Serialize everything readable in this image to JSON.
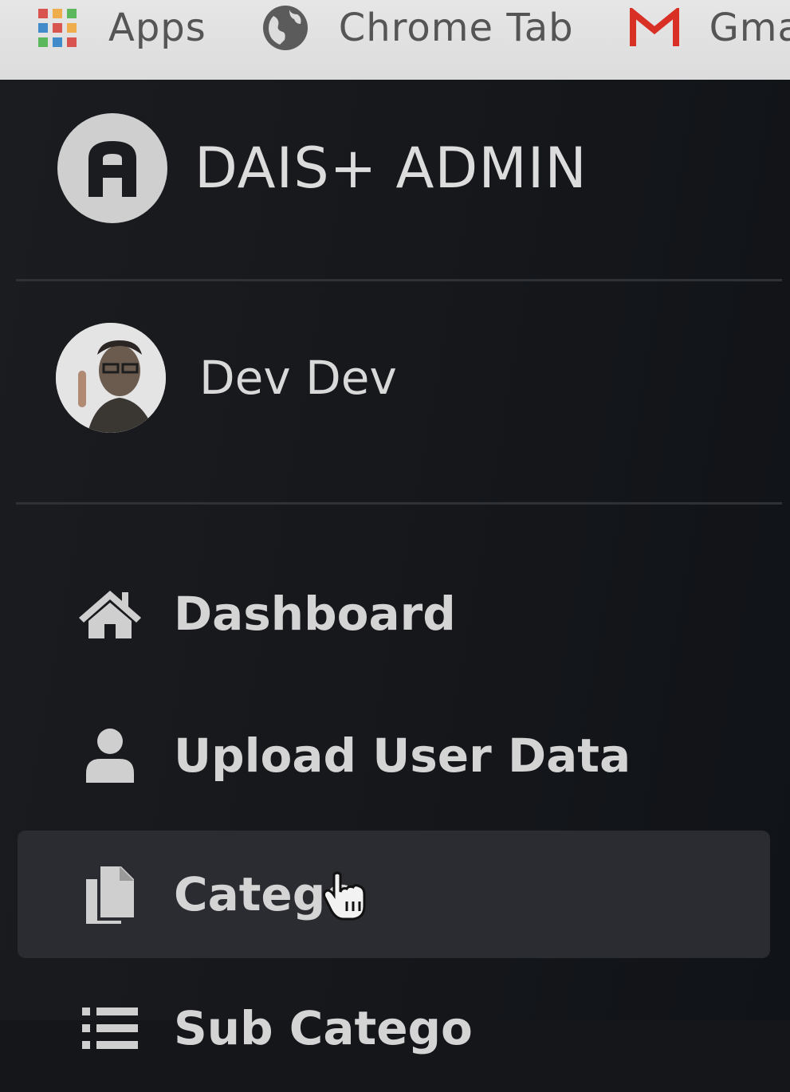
{
  "bookmarks_bar": {
    "items": [
      {
        "label": "Apps",
        "icon": "apps-grid-icon"
      },
      {
        "label": "Chrome Tab",
        "icon": "globe-icon"
      },
      {
        "label": "Gma",
        "icon": "gmail-icon"
      }
    ]
  },
  "sidebar": {
    "brand": {
      "name": "DAIS+ ADMIN",
      "logo_letter": "A"
    },
    "user": {
      "name": "Dev Dev",
      "icon": "avatar"
    },
    "nav": [
      {
        "label": "Dashboard",
        "icon": "home-icon"
      },
      {
        "label": "Upload User Data",
        "icon": "user-icon"
      },
      {
        "label": "Catego",
        "icon": "copy-icon",
        "active": true
      },
      {
        "label": "Sub Catego",
        "icon": "list-icon"
      }
    ]
  },
  "colors": {
    "sidebar_bg": "#15171b",
    "active_bg": "#2a2c31",
    "text": "#d4d4d4",
    "gmail_red": "#d93025"
  }
}
